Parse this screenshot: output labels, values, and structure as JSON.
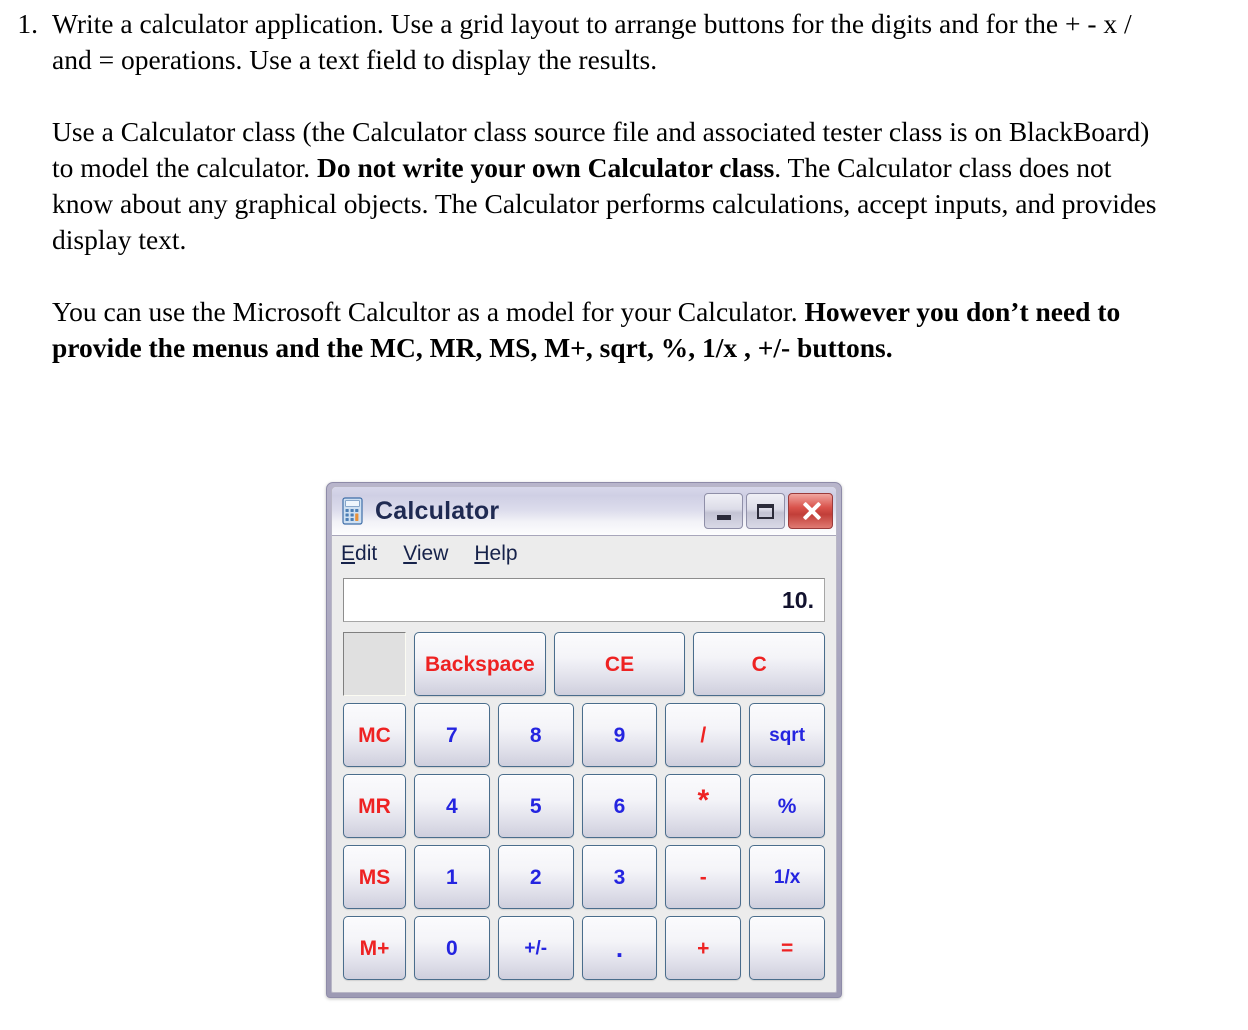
{
  "document": {
    "item_number": "1.",
    "paragraphs": [
      "Write a calculator application.  Use a grid layout to arrange buttons for the digits and for the + - x / and = operations.  Use a text field to display the results.",
      "Use a Calculator class  (the Calculator class source file and associated tester class is on BlackBoard) to model the calculator.  ",
      "You can use the Microsoft Calcultor as a model for your Calculator.  "
    ],
    "p2_bold": "Do not write your own Calculator class",
    "p2_tail": ". The Calculator class does not know about any graphical objects.  The Calculator performs calculations, accept inputs, and provides display text.",
    "p3_bold": "However you don’t need to provide the menus and the MC, MR, MS, M+, sqrt, %, 1/x , +/- buttons."
  },
  "calculator": {
    "title": "Calculator",
    "icon": "calculator-icon",
    "window_controls": {
      "minimize": "minimize-icon",
      "maximize": "maximize-icon",
      "close": "close-icon"
    },
    "menu": [
      {
        "accel": "E",
        "rest": "dit"
      },
      {
        "accel": "V",
        "rest": "iew"
      },
      {
        "accel": "H",
        "rest": "elp"
      }
    ],
    "display_value": "10.",
    "memory_indicator": "",
    "rows": [
      [
        {
          "label": "Backspace",
          "color": "red",
          "kind": "wide",
          "name": "backspace-button"
        },
        {
          "label": "CE",
          "color": "red",
          "kind": "wide",
          "name": "clear-entry-button"
        },
        {
          "label": "C",
          "color": "red",
          "kind": "wide",
          "name": "clear-button"
        }
      ],
      [
        {
          "label": "MC",
          "color": "red",
          "kind": "mem",
          "name": "memory-clear-button"
        },
        {
          "label": "7",
          "color": "blue",
          "kind": "key",
          "name": "digit-7-button"
        },
        {
          "label": "8",
          "color": "blue",
          "kind": "key",
          "name": "digit-8-button"
        },
        {
          "label": "9",
          "color": "blue",
          "kind": "key",
          "name": "digit-9-button"
        },
        {
          "label": "/",
          "color": "red",
          "kind": "key",
          "name": "divide-button"
        },
        {
          "label": "sqrt",
          "color": "blue",
          "kind": "small",
          "name": "sqrt-button"
        }
      ],
      [
        {
          "label": "MR",
          "color": "red",
          "kind": "mem",
          "name": "memory-recall-button"
        },
        {
          "label": "4",
          "color": "blue",
          "kind": "key",
          "name": "digit-4-button"
        },
        {
          "label": "5",
          "color": "blue",
          "kind": "key",
          "name": "digit-5-button"
        },
        {
          "label": "6",
          "color": "blue",
          "kind": "key",
          "name": "digit-6-button"
        },
        {
          "label": "*",
          "color": "red",
          "kind": "star",
          "name": "multiply-button"
        },
        {
          "label": "%",
          "color": "blue",
          "kind": "key",
          "name": "percent-button"
        }
      ],
      [
        {
          "label": "MS",
          "color": "red",
          "kind": "mem",
          "name": "memory-store-button"
        },
        {
          "label": "1",
          "color": "blue",
          "kind": "key",
          "name": "digit-1-button"
        },
        {
          "label": "2",
          "color": "blue",
          "kind": "key",
          "name": "digit-2-button"
        },
        {
          "label": "3",
          "color": "blue",
          "kind": "key",
          "name": "digit-3-button"
        },
        {
          "label": "-",
          "color": "red",
          "kind": "key",
          "name": "subtract-button"
        },
        {
          "label": "1/x",
          "color": "blue",
          "kind": "small",
          "name": "reciprocal-button"
        }
      ],
      [
        {
          "label": "M+",
          "color": "red",
          "kind": "mem",
          "name": "memory-add-button"
        },
        {
          "label": "0",
          "color": "blue",
          "kind": "key",
          "name": "digit-0-button"
        },
        {
          "label": "+/-",
          "color": "blue",
          "kind": "small",
          "name": "sign-toggle-button"
        },
        {
          "label": ".",
          "color": "blue",
          "kind": "dot",
          "name": "decimal-point-button"
        },
        {
          "label": "+",
          "color": "red",
          "kind": "key",
          "name": "add-button"
        },
        {
          "label": "=",
          "color": "red",
          "kind": "key",
          "name": "equals-button"
        }
      ]
    ]
  },
  "colors": {
    "key_red": "#ee2222",
    "key_blue": "#2424e0",
    "window_frame": "#a8a5bd",
    "body_bg": "#ececec",
    "close_button": "#d9524b"
  }
}
